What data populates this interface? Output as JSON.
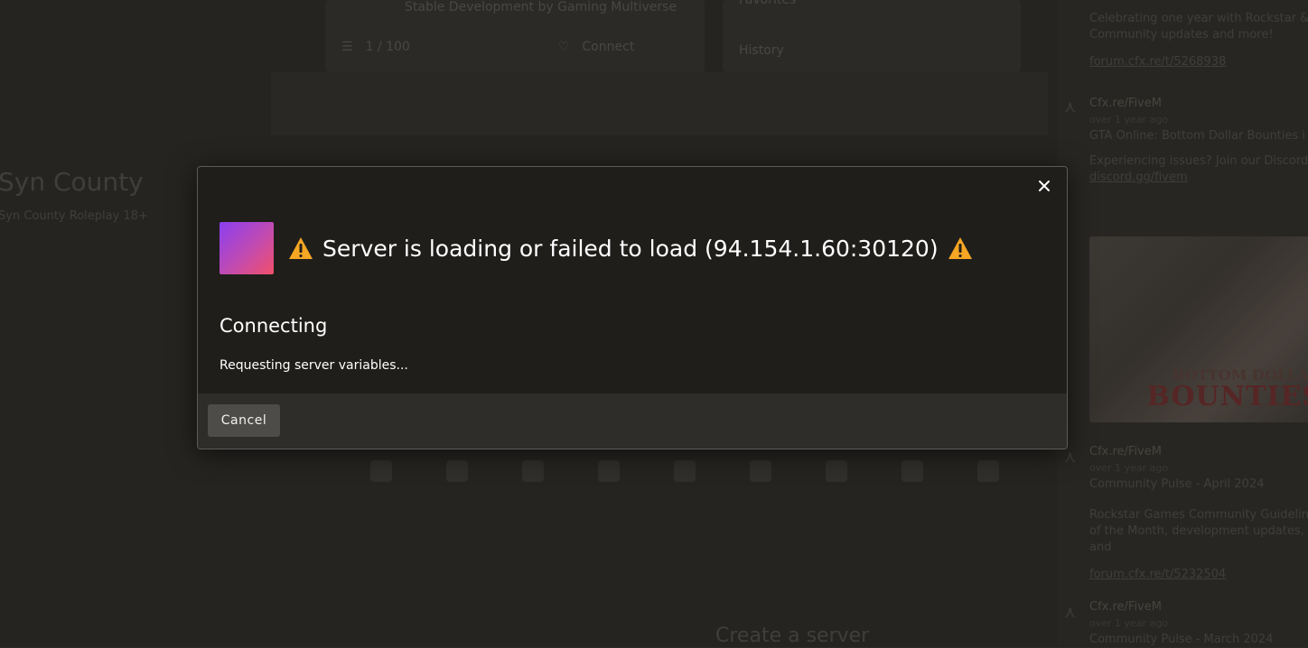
{
  "background": {
    "server_card": {
      "subtitle": "Stable Development by Gaming Multiverse",
      "players": "1 / 100",
      "action": "Connect"
    },
    "sidebar_links": {
      "favorites": "Favorites",
      "history": "History"
    },
    "server": {
      "name": "Syn County",
      "description": "Syn County Roleplay 18+"
    },
    "create_server": "Create a server",
    "feed": [
      {
        "text": "Celebrating one year with Rockstar & Community updates and more!",
        "link": "forum.cfx.re/t/5268938"
      },
      {
        "author": "Cfx.re/FiveM",
        "ago": "over 1 year ago",
        "text": "GTA Online: Bottom Dollar Bounties is testing on FiveM's canary release channel, platform server version 8881 or higher.",
        "text2": "Experiencing issues? Join our Discord: ",
        "link": "discord.gg/fivem",
        "image_text_1": "BOTTOM DOLLAR",
        "image_text_2": "BOUNTIES"
      },
      {
        "author": "Cfx.re/FiveM",
        "ago": "over 1 year ago",
        "text": "Community Pulse - April 2024",
        "text2": "Rockstar Games Community Guidelines of the Month, development updates, and",
        "link": "forum.cfx.re/t/5232504"
      },
      {
        "author": "Cfx.re/FiveM",
        "ago": "over 1 year ago",
        "text": "Community Pulse - March 2024"
      }
    ]
  },
  "modal": {
    "title": "Server is loading or failed to load (94.154.1.60:30120)",
    "state": "Connecting",
    "detail": "Requesting server variables...",
    "cancel_label": "Cancel",
    "warning_color": "#f5a623",
    "icons": {
      "close": "close-icon",
      "warning": "warning-icon"
    }
  }
}
